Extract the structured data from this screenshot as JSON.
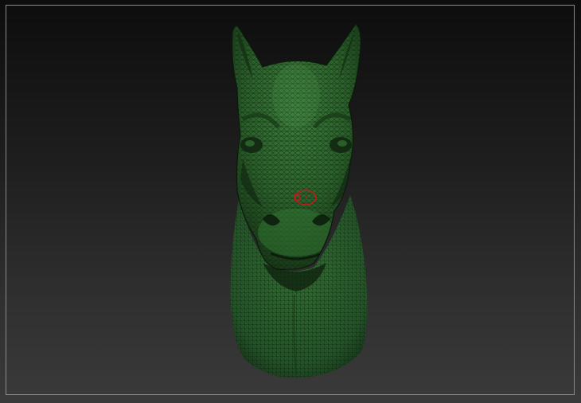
{
  "viewport": {
    "background_top": "#0d0d0d",
    "background_bottom": "#3a3a3a",
    "frame_color": "#8a8a8a"
  },
  "model": {
    "subject": "horse-head-bust",
    "surface_color": "#2f6a2f",
    "wire_color": "#0d1f0d"
  },
  "brush_cursor": {
    "icon": "brush-circle-cursor-icon",
    "color": "#c21a1a"
  }
}
